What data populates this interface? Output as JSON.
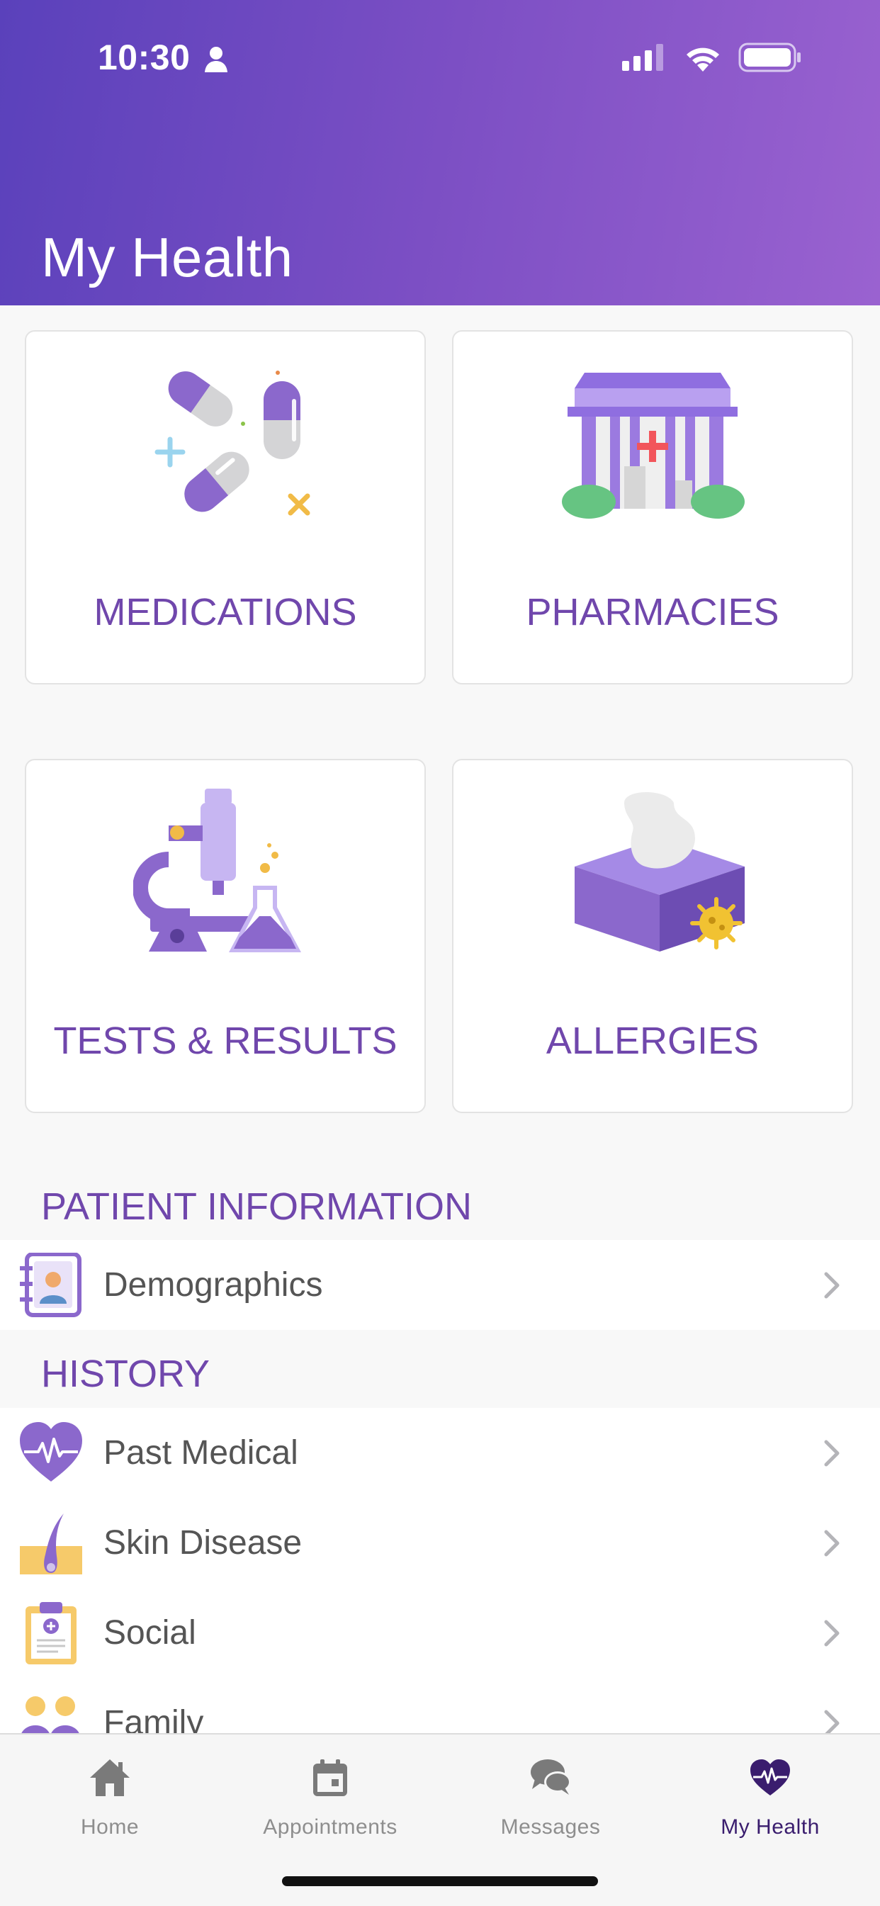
{
  "status_bar": {
    "time": "10:30"
  },
  "header": {
    "title": "My Health"
  },
  "cards": [
    {
      "label": "MEDICATIONS",
      "icon": "pills-icon"
    },
    {
      "label": "PHARMACIES",
      "icon": "pharmacy-building-icon"
    },
    {
      "label": "TESTS & RESULTS",
      "icon": "microscope-icon"
    },
    {
      "label": "ALLERGIES",
      "icon": "tissue-box-icon"
    }
  ],
  "patient_information": {
    "title": "PATIENT INFORMATION",
    "items": [
      {
        "label": "Demographics",
        "icon": "contact-card-icon"
      }
    ]
  },
  "history": {
    "title": "HISTORY",
    "items": [
      {
        "label": "Past Medical",
        "icon": "heartbeat-icon"
      },
      {
        "label": "Skin Disease",
        "icon": "skin-hair-icon"
      },
      {
        "label": "Social",
        "icon": "clipboard-icon"
      },
      {
        "label": "Family",
        "icon": "family-icon"
      }
    ]
  },
  "tabbar": {
    "tabs": [
      {
        "label": "Home",
        "icon": "home-icon",
        "active": false
      },
      {
        "label": "Appointments",
        "icon": "calendar-icon",
        "active": false
      },
      {
        "label": "Messages",
        "icon": "chat-bubbles-icon",
        "active": false
      },
      {
        "label": "My Health",
        "icon": "heartbeat-heart-icon",
        "active": true
      }
    ]
  },
  "colors": {
    "accent": "#7047ac",
    "header_start": "#5a41bb",
    "header_end": "#9a62d0",
    "tab_active": "#3a1d6e"
  }
}
